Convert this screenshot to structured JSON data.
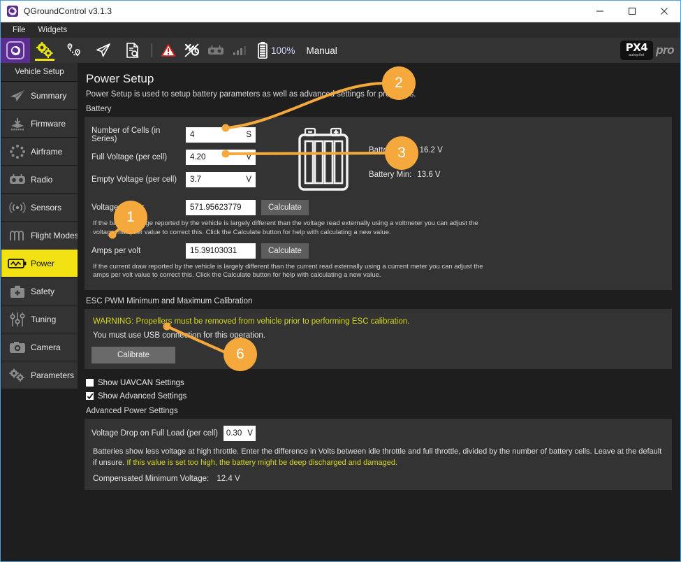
{
  "window": {
    "title": "QGroundControl v3.1.3",
    "app_icon": "qgc-logo-icon",
    "minimize": "minimize-icon",
    "maximize": "maximize-icon",
    "close": "close-icon"
  },
  "menubar": {
    "items": [
      {
        "label": "File"
      },
      {
        "label": "Widgets"
      }
    ]
  },
  "toolbar": {
    "home_icon": "qgc-home-icon",
    "buttons": [
      {
        "icon": "gears-icon",
        "name": "vehicle-setup",
        "active": true
      },
      {
        "icon": "plan-route-icon",
        "name": "plan",
        "active": false
      },
      {
        "icon": "fly-paper-plane-icon",
        "name": "fly",
        "active": false
      },
      {
        "icon": "analyze-document-icon",
        "name": "analyze",
        "active": false
      }
    ],
    "status": [
      {
        "icon": "warning-triangle-icon",
        "name": "vehicle-messages"
      },
      {
        "icon": "gps-satellite-disconnected-icon",
        "name": "gps-status"
      },
      {
        "icon": "rc-controller-icon",
        "name": "rc-status"
      },
      {
        "icon": "signal-bars-icon",
        "name": "telemetry-signal"
      }
    ],
    "battery_icon": "battery-icon",
    "battery_percent": "100%",
    "flight_mode": "Manual",
    "brand": {
      "name": "PX4",
      "sub": "autopilot",
      "suffix": "pro"
    }
  },
  "sidebar": {
    "header": "Vehicle Setup",
    "items": [
      {
        "label": "Summary",
        "icon": "summary-plane-icon",
        "selected": false
      },
      {
        "label": "Firmware",
        "icon": "firmware-download-icon",
        "selected": false
      },
      {
        "label": "Airframe",
        "icon": "airframe-icon",
        "selected": false
      },
      {
        "label": "Radio",
        "icon": "radio-controller-icon",
        "selected": false
      },
      {
        "label": "Sensors",
        "icon": "sensors-waves-icon",
        "selected": false
      },
      {
        "label": "Flight Modes",
        "icon": "flight-modes-icon",
        "selected": false
      },
      {
        "label": "Power",
        "icon": "power-battery-icon",
        "selected": true
      },
      {
        "label": "Safety",
        "icon": "safety-kit-icon",
        "selected": false
      },
      {
        "label": "Tuning",
        "icon": "tuning-sliders-icon",
        "selected": false
      },
      {
        "label": "Camera",
        "icon": "camera-icon",
        "selected": false
      },
      {
        "label": "Parameters",
        "icon": "parameters-gears-icon",
        "selected": false
      }
    ]
  },
  "page": {
    "title": "Power Setup",
    "description": "Power Setup is used to setup battery parameters as well as advanced settings for propellers.",
    "battery_section_label": "Battery",
    "battery": {
      "rows": [
        {
          "label": "Number of Cells (in Series)",
          "value": "4",
          "unit": "S"
        },
        {
          "label": "Full Voltage (per cell)",
          "value": "4.20",
          "unit": "V"
        },
        {
          "label": "Empty Voltage (per cell)",
          "value": "3.7",
          "unit": "V"
        }
      ],
      "max_label": "Battery Max:",
      "max_value": "16.2 V",
      "min_label": "Battery Min:",
      "min_value": "13.6 V",
      "battery_graphic": "battery-cells-icon"
    },
    "voltage_divider": {
      "label": "Voltage divider",
      "value": "571.95623779",
      "button": "Calculate",
      "help": "If the battery voltage reported by the vehicle is largely different than the voltage read externally using a voltmeter you can adjust the voltage multiplier value to correct this. Click the Calculate button for help with calculating a new value."
    },
    "amps_per_volt": {
      "label": "Amps per volt",
      "value": "15.39103031",
      "button": "Calculate",
      "help": "If the current draw reported by the vehicle is largely different than the current read externally using a current meter you can adjust the amps per volt value to correct this. Click the Calculate button for help with calculating a new value."
    },
    "esc": {
      "section_label": "ESC PWM Minimum and Maximum Calibration",
      "warning": "WARNING: Propellers must be removed from vehicle prior to performing ESC calibration.",
      "note": "You must use USB connection for this operation.",
      "button": "Calibrate"
    },
    "checkboxes": [
      {
        "label": "Show UAVCAN Settings",
        "checked": false,
        "name": "show-uavcan-settings"
      },
      {
        "label": "Show Advanced Settings",
        "checked": true,
        "name": "show-advanced-settings"
      }
    ],
    "advanced": {
      "section_label": "Advanced Power Settings",
      "drop_label": "Voltage Drop on Full Load (per cell)",
      "drop_value": "0.30",
      "drop_unit": "V",
      "body_text": "Batteries show less voltage at high throttle. Enter the difference in Volts between idle throttle and full throttle, divided by the number of battery cells. Leave at the default if unsure. ",
      "body_warning": "If this value is set too high, the battery might be deep discharged and damaged.",
      "compensated_label": "Compensated Minimum Voltage:",
      "compensated_value": "12.4 V"
    }
  },
  "callouts": {
    "accent": "#f5a93c",
    "items": [
      {
        "number": "1",
        "target": "power-sidebar-item"
      },
      {
        "number": "2",
        "target": "number-of-cells-field"
      },
      {
        "number": "3",
        "target": "full-voltage-field"
      },
      {
        "number": "6",
        "target": "calibrate-button"
      }
    ]
  }
}
